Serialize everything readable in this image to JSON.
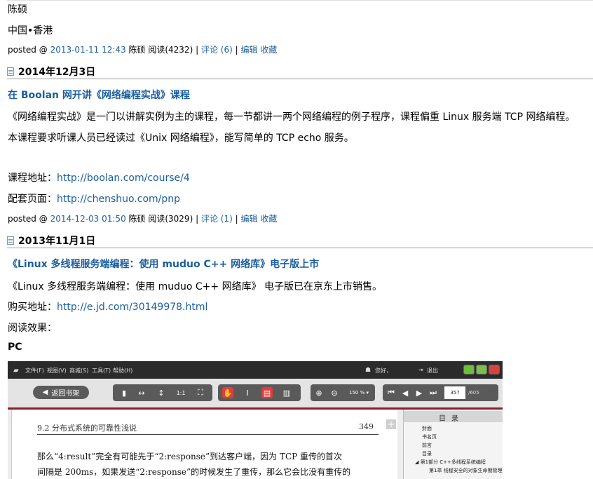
{
  "post1": {
    "sig_name": "陈硕",
    "sig_location": "中国•香港",
    "meta": {
      "prefix": "posted @",
      "datetime": "2013-01-11 12:43",
      "author_reads": "陈硕 阅读(4232)",
      "sep1": "|",
      "comments": "评论 (6)",
      "sep2": "|",
      "edit": "编辑",
      "fav": "收藏"
    }
  },
  "day2": {
    "date": "2014年12月3日"
  },
  "post2": {
    "title": "在 Boolan 网开讲《网络编程实战》课程",
    "p1": "《网络编程实战》是一门以讲解实例为主的课程，每一节都讲一两个网络编程的例子程序，课程偏重 Linux 服务端 TCP 网络编程。",
    "p2": "本课程要求听课人员已经读过《Unix 网络编程》，能写简单的 TCP echo 服务。",
    "course_label": "课程地址：",
    "course_url": "http://boolan.com/course/4",
    "page_label": "配套页面：",
    "page_url": "http://chenshuo.com/pnp",
    "meta": {
      "prefix": "posted @",
      "datetime": "2014-12-03 01:50",
      "author_reads": "陈硕 阅读(3029)",
      "sep1": "|",
      "comments": "评论 (1)",
      "sep2": "|",
      "edit": "编辑",
      "fav": "收藏"
    }
  },
  "day3": {
    "date": "2013年11月1日"
  },
  "post3": {
    "title": "《Linux 多线程服务端编程：使用 muduo C++ 网络库》电子版上市",
    "p1": "《Linux 多线程服务端编程：使用 muduo C++ 网络库》 电子版已在京东上市销售。",
    "buy_label": "购买地址：",
    "buy_url": "http://e.jd.com/30149978.html",
    "effect": "阅读效果：",
    "pc": "PC"
  },
  "reader": {
    "menus": [
      "文件(F)",
      "视图(V)",
      "商城(S)",
      "工具(T)",
      "帮助(H)"
    ],
    "greeting": "您好，",
    "logout": "退出",
    "back": "返回书架",
    "zoom": "150 %",
    "page_current": "357",
    "page_total": "/605",
    "header_left": "9.2   分布式系统的可靠性浅说",
    "header_page": "349",
    "body_line1": "那么“4:result”完全有可能先于“2:response”到达客户端，因为 TCP 重传的首次",
    "body_line2": "间隔是 200ms，如果发送“2:response”的时候发生了重传，那么它会比没有重传的",
    "toc_title": "目录",
    "toc_items": [
      "封面",
      "书名页",
      "前言",
      "目录",
      "第1部分  C++多线程系统编程",
      "第1章  线程安全的对象生命期管理"
    ]
  },
  "colors": {
    "link": "#1a5e9e",
    "accent_red": "#e33b3b",
    "toolbar_dark": "#5a5a5a",
    "menubar": "#2b2b2b"
  }
}
